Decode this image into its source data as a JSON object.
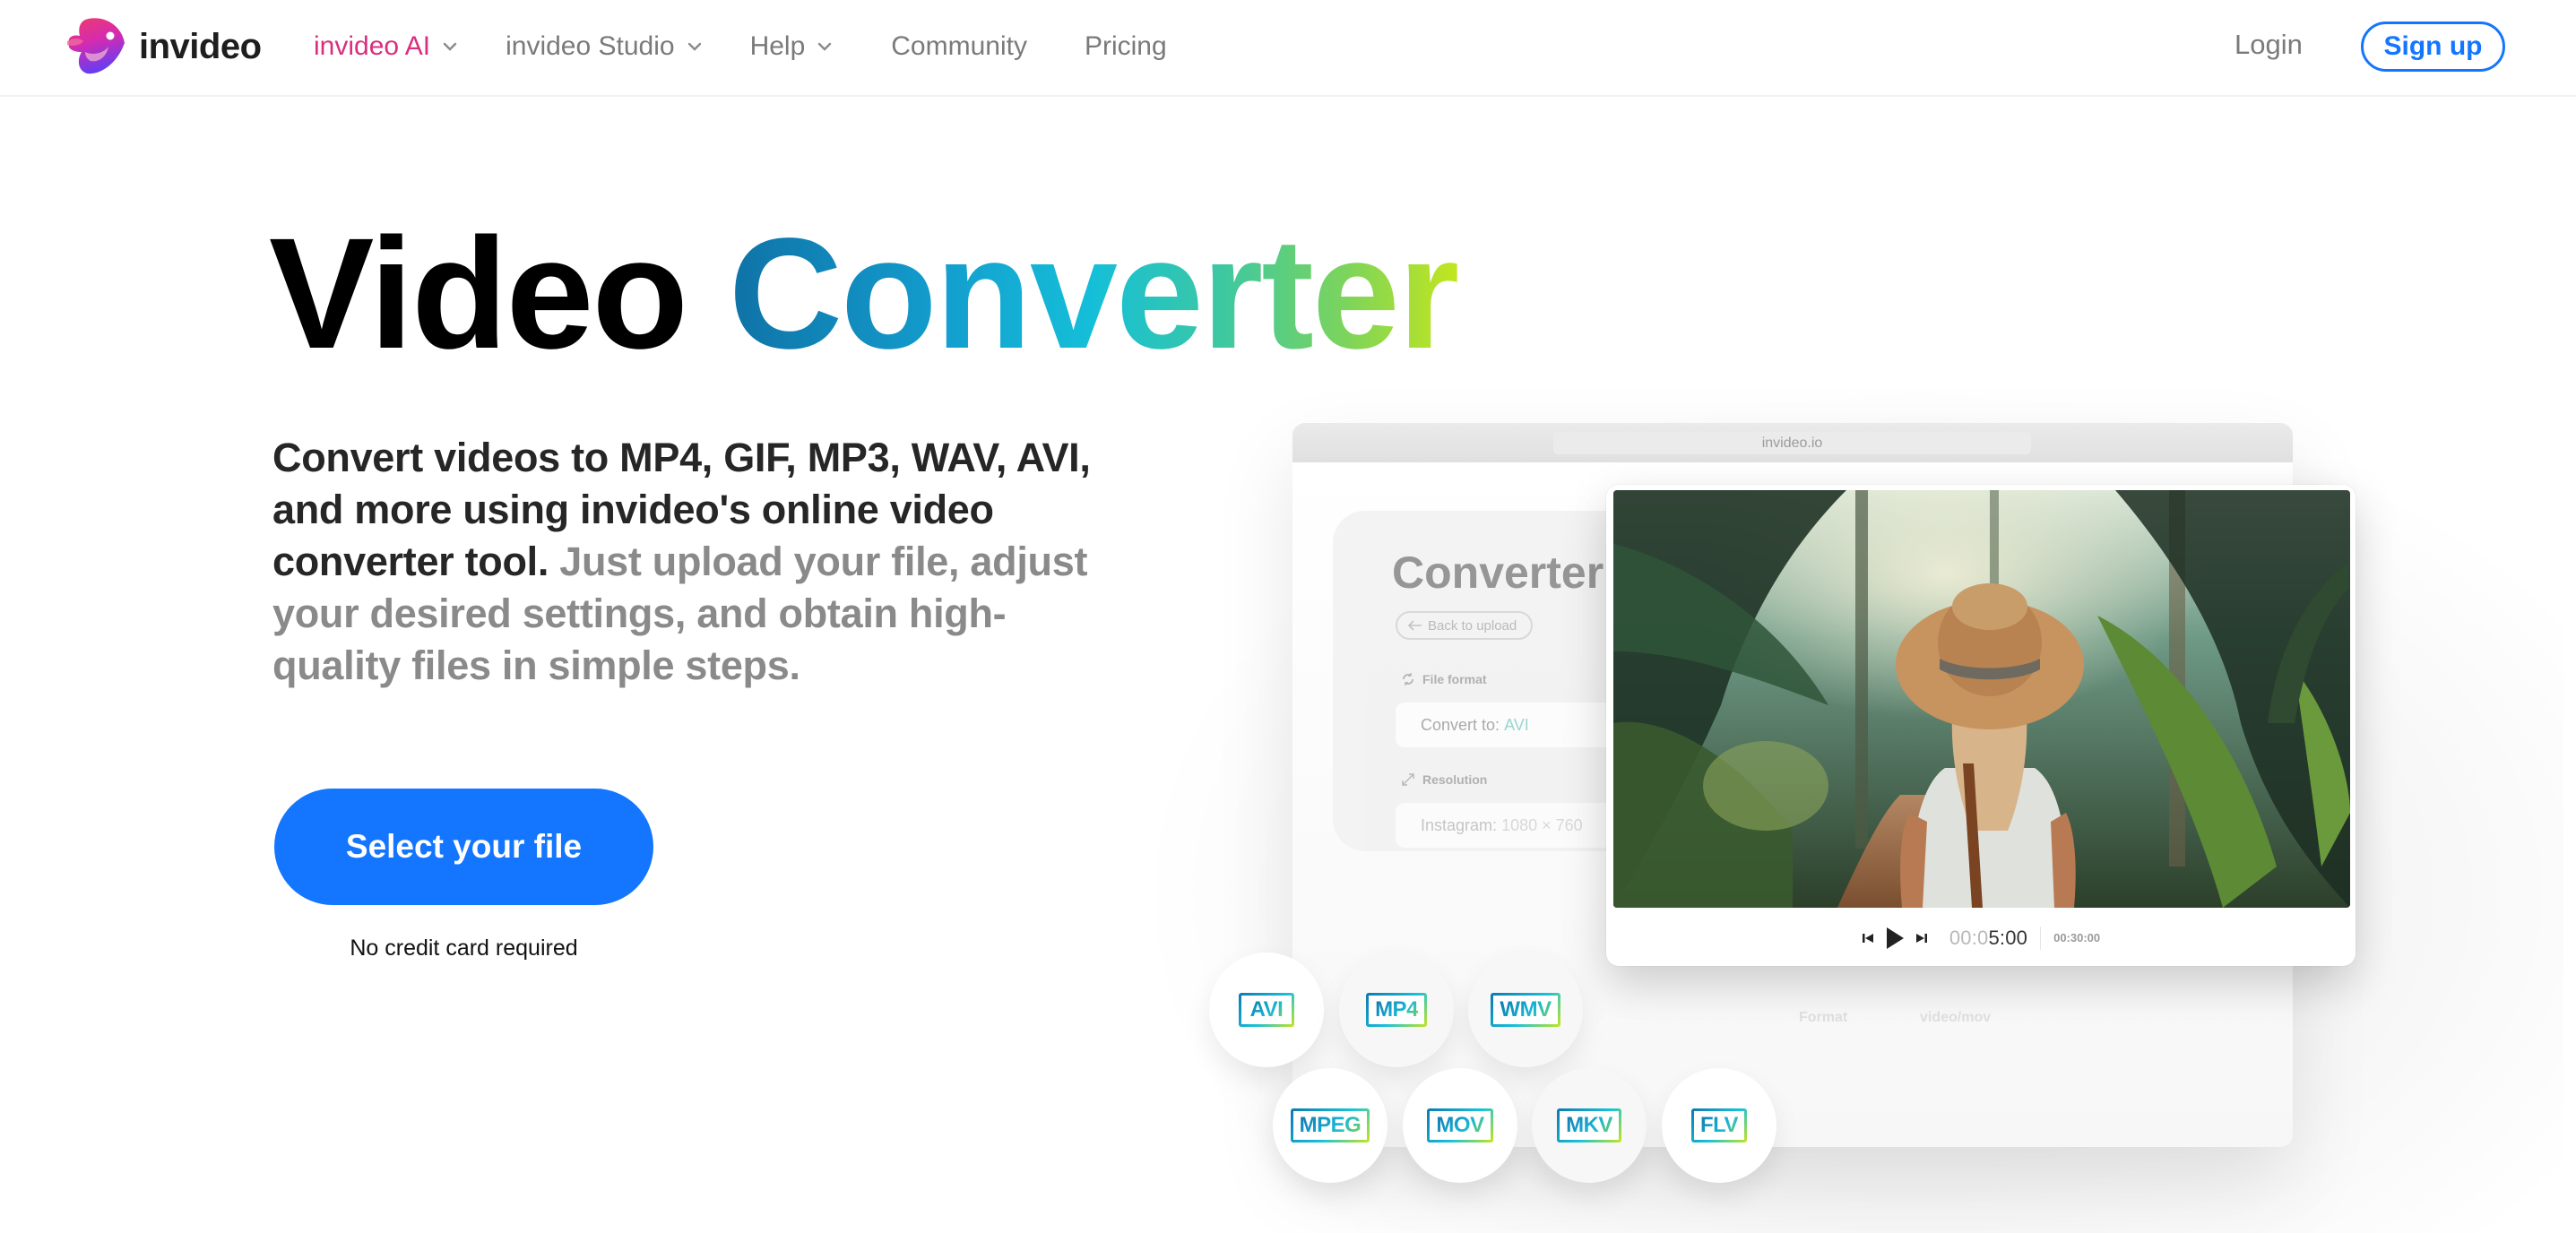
{
  "header": {
    "brand": "invideo",
    "nav": [
      {
        "label": "invideo AI",
        "has_dropdown": true,
        "active": true
      },
      {
        "label": "invideo Studio",
        "has_dropdown": true,
        "active": false
      },
      {
        "label": "Help",
        "has_dropdown": true,
        "active": false
      },
      {
        "label": "Community",
        "has_dropdown": false,
        "active": false
      },
      {
        "label": "Pricing",
        "has_dropdown": false,
        "active": false
      }
    ],
    "login_label": "Login",
    "signup_label": "Sign up"
  },
  "hero": {
    "title_plain": "Video",
    "title_gradient": "Converter",
    "description_strong": "Convert videos to MP4, GIF, MP3, WAV, AVI, and more using invideo's online video converter tool.",
    "description_muted": "Just upload your file, adjust your desired settings, and obtain high-quality files in simple steps.",
    "cta_label": "Select your file",
    "cta_note": "No credit card required"
  },
  "mockup": {
    "url": "invideo.io",
    "panel_title": "Converter",
    "back_label": "Back to upload",
    "file_format_label": "File format",
    "convert_to_prefix": "Convert to:",
    "convert_to_value": "AVI",
    "resolution_label": "Resolution",
    "resolution_prefix": "Instagram:",
    "resolution_value": "1080 × 760",
    "faint_format_label": "Format",
    "faint_format_value": "video/mov",
    "player": {
      "current_time_dim": "00:0",
      "current_time_bright": "5:00",
      "total_time": "00:30:00"
    },
    "formats": [
      "AVI",
      "MP4",
      "WMV",
      "MPEG",
      "MOV",
      "MKV",
      "FLV"
    ]
  },
  "colors": {
    "brand_pink": "#d92f7e",
    "primary_blue": "#1476ff"
  }
}
